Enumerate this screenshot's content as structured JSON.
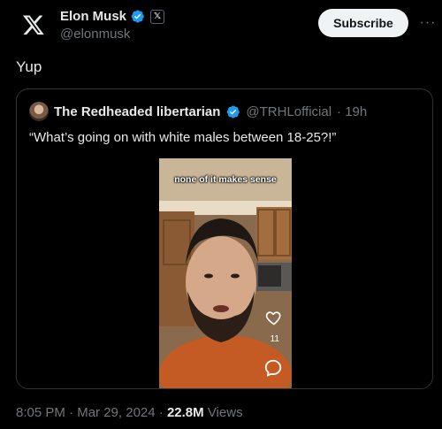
{
  "author": {
    "name": "Elon Musk",
    "handle": "@elonmusk",
    "affiliation_badge": "𝕏"
  },
  "subscribe_label": "Subscribe",
  "more_label": "···",
  "tweet_text": "Yup",
  "quote": {
    "author_name": "The Redheaded libertarian",
    "author_handle": "@TRHLofficial",
    "time": "· 19h",
    "text": "“What’s going on with white males between 18-25?!”",
    "video": {
      "caption": "none of it makes sense",
      "like_count": "11"
    }
  },
  "meta": {
    "time": "8:05 PM",
    "sep1": " · ",
    "date": "Mar 29, 2024",
    "sep2": " · ",
    "views_count": "22.8M",
    "views_label": " Views"
  },
  "colors": {
    "background": "#000000",
    "verified": "#1d9bf0",
    "secondary_text": "#71767b"
  },
  "icons": [
    "x-logo-icon",
    "verified-icon",
    "more-icon",
    "heart-icon",
    "comment-icon"
  ]
}
